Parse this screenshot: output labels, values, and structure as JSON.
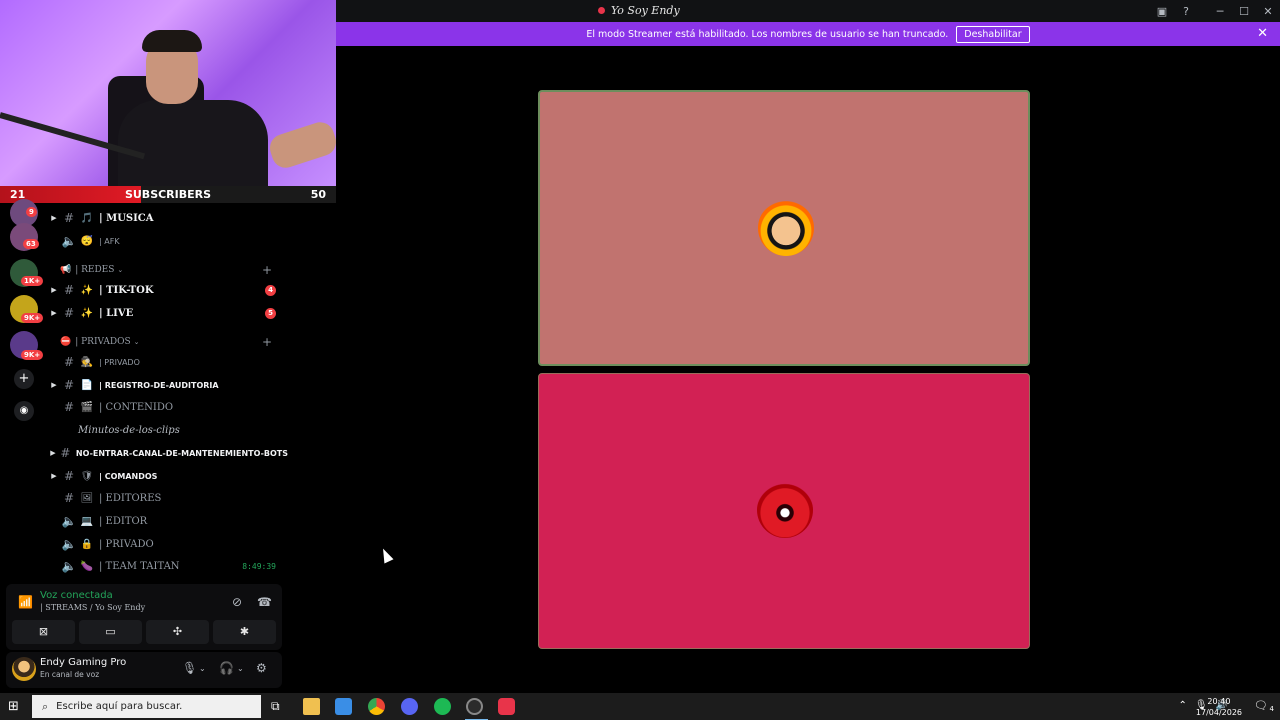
{
  "window": {
    "title": "Yo Soy Endy",
    "controls": [
      "inbox-icon",
      "help-icon",
      "minimize-icon",
      "maximize-icon",
      "close-icon"
    ]
  },
  "banner": {
    "text": "El modo Streamer está habilitado. Los nombres de usuario se han truncado.",
    "button": "Deshabilitar"
  },
  "overlay": {
    "sub_current": "21",
    "sub_label": "SUBSCRIBERS",
    "sub_goal": "50",
    "sub_progress": 0.42
  },
  "servers": {
    "badges": [
      "9",
      "63",
      "1K+",
      "9K+",
      "9K+"
    ]
  },
  "channels": {
    "items": [
      {
        "icon": "🎵",
        "label": "| MUSICA",
        "type": "text"
      },
      {
        "icon": "😴",
        "label": "| AFK",
        "type": "voice"
      },
      {
        "icon": "✨",
        "label": "| TIK-TOK",
        "type": "text",
        "badge": "4"
      },
      {
        "icon": "✨",
        "label": "| LIVE",
        "type": "text",
        "badge": "5"
      },
      {
        "icon": "🕵",
        "label": "| PRIVADO",
        "type": "text"
      },
      {
        "icon": "📄",
        "label": "| REGISTRO-DE-AUDITORIA",
        "type": "text"
      },
      {
        "icon": "🎬",
        "label": "| CONTENIDO",
        "type": "text"
      },
      {
        "label": "Minutos-de-los-clips",
        "type": "thread"
      },
      {
        "label": "NO-ENTRAR-CANAL-DE-MANTENEMIENTO-BOTS",
        "type": "text"
      },
      {
        "icon": "🛡",
        "label": "| COMANDOS",
        "type": "text"
      },
      {
        "icon": "🖼",
        "label": "| EDITORES",
        "type": "text"
      },
      {
        "icon": "💻",
        "label": "| EDITOR",
        "type": "voice"
      },
      {
        "icon": "🔒",
        "label": "| PRIVADO",
        "type": "voice"
      },
      {
        "icon": "🍆",
        "label": "| TEAM TAITAN",
        "type": "voice",
        "timer": "8:49:39"
      }
    ],
    "categories": [
      {
        "icon": "📢",
        "label": "| REDES"
      },
      {
        "icon": "⛔",
        "label": "| PRIVADOS"
      }
    ]
  },
  "voice": {
    "status": "Voz conectada",
    "channel": "| STREAMS / Yo Soy Endy"
  },
  "user": {
    "name": "Endy Gaming Pro",
    "status": "En canal de voz"
  },
  "taskbar": {
    "search_placeholder": "Escribe aquí para buscar.",
    "time": "20:40",
    "date": "17/04/2026",
    "notif_count": "4"
  },
  "colors": {
    "banner": "#8b34e9",
    "tile_top": "#c1736f",
    "tile_bottom": "#d22154",
    "voice_green": "#23a55a"
  }
}
